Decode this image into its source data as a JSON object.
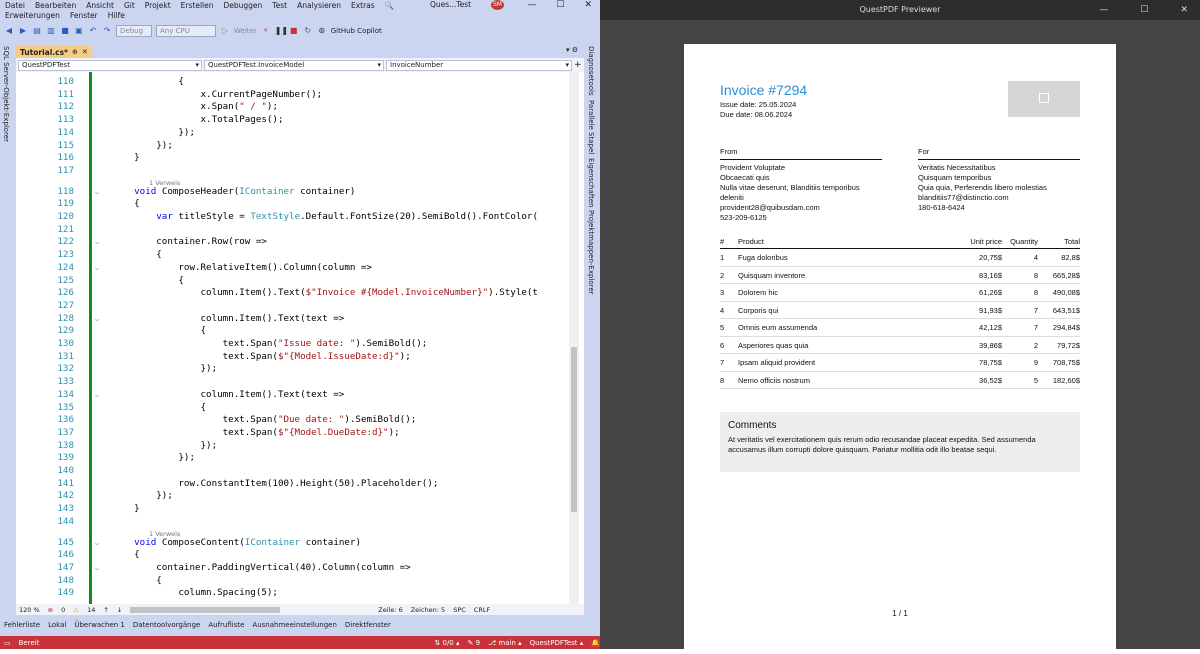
{
  "vs": {
    "menu_row1": [
      "Datei",
      "Bearbeiten",
      "Ansicht",
      "Git",
      "Projekt",
      "Erstellen",
      "Debuggen",
      "Test",
      "Analysieren",
      "Extras"
    ],
    "menu_row2": [
      "Erweiterungen",
      "Fenster",
      "Hilfe"
    ],
    "search_icon": "🔍",
    "window_title": "Ques...Test",
    "avatar_initials": "SM",
    "window_buttons": [
      "—",
      "☐",
      "✕"
    ],
    "toolbar": {
      "config": "Debug",
      "platform": "Any CPU",
      "continue_label": "Weiter",
      "copilot_label": "GitHub Copilot"
    },
    "left_tab": "SQL Server-Objekt-Explorer",
    "right_tabs": [
      "Diagnosetools",
      "Parallele Stapel",
      "Eigenschaften",
      "Projektmappen-Explorer"
    ],
    "doc_tab": {
      "title": "Tutorial.cs*",
      "pin": "⊕",
      "close": "✕"
    },
    "doc_tab_right": "▾ ⚙",
    "nav": {
      "project": "QuestPDFTest",
      "type": "QuestPDFTest.InvoiceModel",
      "member": "InvoiceNumber"
    },
    "reference_label": "1 Verweis",
    "code_lines": [
      {
        "n": "110",
        "t": "            {"
      },
      {
        "n": "111",
        "t": "                x.CurrentPageNumber();"
      },
      {
        "n": "112",
        "t": "                x.Span(\" / \");"
      },
      {
        "n": "113",
        "t": "                x.TotalPages();"
      },
      {
        "n": "114",
        "t": "            });"
      },
      {
        "n": "115",
        "t": "        });"
      },
      {
        "n": "116",
        "t": "    }"
      },
      {
        "n": "117",
        "t": ""
      },
      {
        "n": "118",
        "t": "    void ComposeHeader(IContainer container)",
        "ref": true
      },
      {
        "n": "119",
        "t": "    {"
      },
      {
        "n": "120",
        "t": "        var titleStyle = TextStyle.Default.FontSize(20).SemiBold().FontColor("
      },
      {
        "n": "121",
        "t": ""
      },
      {
        "n": "122",
        "t": "        container.Row(row =>"
      },
      {
        "n": "123",
        "t": "        {"
      },
      {
        "n": "124",
        "t": "            row.RelativeItem().Column(column =>"
      },
      {
        "n": "125",
        "t": "            {"
      },
      {
        "n": "126",
        "t": "                column.Item().Text($\"Invoice #{Model.InvoiceNumber}\").Style(t"
      },
      {
        "n": "127",
        "t": ""
      },
      {
        "n": "128",
        "t": "                column.Item().Text(text =>"
      },
      {
        "n": "129",
        "t": "                {"
      },
      {
        "n": "130",
        "t": "                    text.Span(\"Issue date: \").SemiBold();"
      },
      {
        "n": "131",
        "t": "                    text.Span($\"{Model.IssueDate:d}\");"
      },
      {
        "n": "132",
        "t": "                });"
      },
      {
        "n": "133",
        "t": ""
      },
      {
        "n": "134",
        "t": "                column.Item().Text(text =>"
      },
      {
        "n": "135",
        "t": "                {"
      },
      {
        "n": "136",
        "t": "                    text.Span(\"Due date: \").SemiBold();"
      },
      {
        "n": "137",
        "t": "                    text.Span($\"{Model.DueDate:d}\");"
      },
      {
        "n": "138",
        "t": "                });"
      },
      {
        "n": "139",
        "t": "            });"
      },
      {
        "n": "140",
        "t": ""
      },
      {
        "n": "141",
        "t": "            row.ConstantItem(100).Height(50).Placeholder();"
      },
      {
        "n": "142",
        "t": "        });"
      },
      {
        "n": "143",
        "t": "    }"
      },
      {
        "n": "144",
        "t": ""
      },
      {
        "n": "145",
        "t": "    void ComposeContent(IContainer container)",
        "ref": true
      },
      {
        "n": "146",
        "t": "    {"
      },
      {
        "n": "147",
        "t": "        container.PaddingVertical(40).Column(column =>"
      },
      {
        "n": "148",
        "t": "        {"
      },
      {
        "n": "149",
        "t": "            column.Spacing(5);"
      }
    ],
    "status_line": {
      "zoom": "120 %",
      "errors": "0",
      "warnings": "14",
      "line": "Zeile: 6",
      "col": "Zeichen: 5",
      "mode1": "SPC",
      "mode2": "CRLF"
    },
    "bottom_tabs": [
      "Fehlerliste",
      "Lokal",
      "Überwachen 1",
      "Datentoolvorgänge",
      "Aufrufliste",
      "Ausnahmeeinstellungen",
      "Direktfenster"
    ],
    "statusbar": {
      "ready": "Bereit",
      "sync": "⇅ 0/0 ▴",
      "edits": "✎ 9",
      "branch": "⎇ main ▴",
      "repo": "QuestPDFTest ▴",
      "bell": "🔔"
    }
  },
  "preview": {
    "window_title": "QuestPDF Previewer",
    "window_buttons": [
      "—",
      "☐",
      "✕"
    ],
    "invoice": {
      "title": "Invoice #7294",
      "issue_date": "Issue date: 25.05.2024",
      "due_date": "Due date: 08.06.2024",
      "from": {
        "heading": "From",
        "lines": [
          "Provident Voluptate",
          "Obcaecati quis",
          "Nulla vitae deserunt, Blanditiis temporibus deleniti",
          "provident28@quibusdam.com",
          "523-209-6125"
        ]
      },
      "for": {
        "heading": "For",
        "lines": [
          "Veritatis Necessitatibus",
          "Quisquam temporibus",
          "Quia quia, Perferendis libero molestias",
          "blanditiis77@distinctio.com",
          "180-618-6424"
        ]
      },
      "headers": [
        "#",
        "Product",
        "Unit price",
        "Quantity",
        "Total"
      ],
      "rows": [
        [
          "1",
          "Fuga doloribus",
          "20,75$",
          "4",
          "82,8$"
        ],
        [
          "2",
          "Quisquam inventore",
          "83,16$",
          "8",
          "665,28$"
        ],
        [
          "3",
          "Dolorem hic",
          "61,26$",
          "8",
          "490,08$"
        ],
        [
          "4",
          "Corporis qui",
          "91,93$",
          "7",
          "643,51$"
        ],
        [
          "5",
          "Omnis eum assumenda",
          "42,12$",
          "7",
          "294,84$"
        ],
        [
          "6",
          "Asperiores quas quia",
          "39,86$",
          "2",
          "79,72$"
        ],
        [
          "7",
          "Ipsam aliquid provident",
          "78,75$",
          "9",
          "708,75$"
        ],
        [
          "8",
          "Nemo officiis nostrum",
          "36,52$",
          "5",
          "182,60$"
        ]
      ],
      "comments_title": "Comments",
      "comments_body": "At veritatis vel exercitationem quis rerum odio recusandae placeat expedita. Sed assumenda accusamus illum corrupti dolore quisquam. Pariatur mollitia odit illo beatae sequi.",
      "page_number": "1 / 1"
    }
  }
}
